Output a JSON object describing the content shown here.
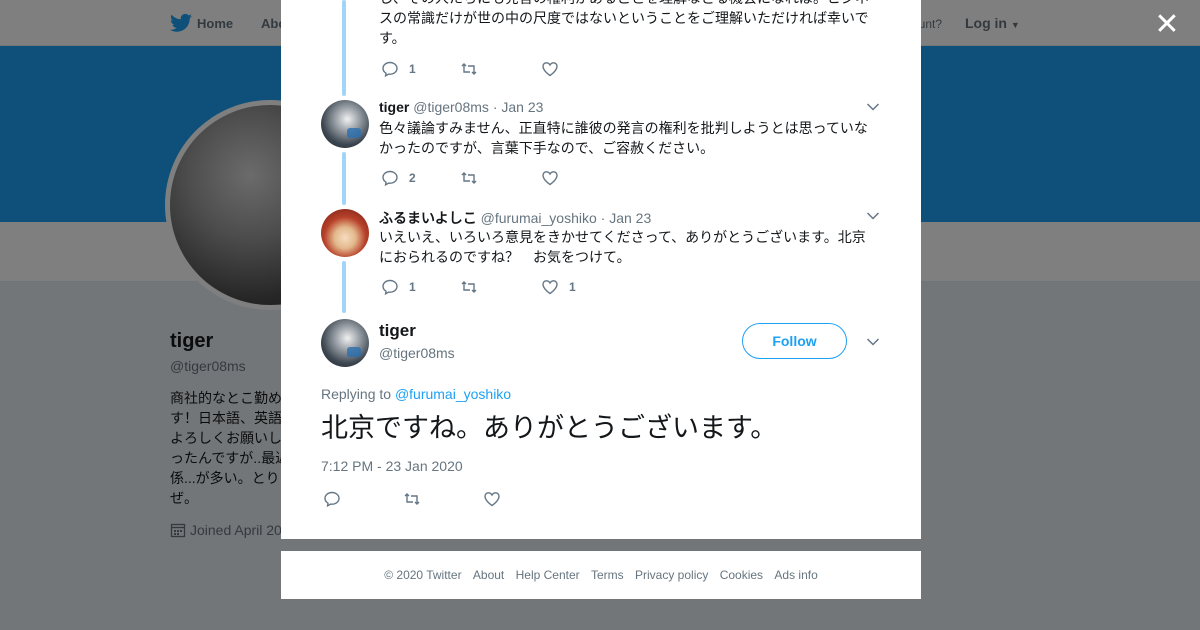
{
  "topbar": {
    "home": "Home",
    "about_partial": "Abo",
    "have_account_partial": "ccount?",
    "login": "Log in"
  },
  "profile": {
    "name": "tiger",
    "handle": "@tiger08ms",
    "bio": "商社的なとこ勤め\nす！日本語、英語\nよろしくお願いし\nったんですが..最近\n係...が多い。とり\nぜ。",
    "joined_partial": "Joined April 20"
  },
  "thread": [
    {
      "text": "し、その人たちにも発言の権利があることを理解などる機会になれば。ビジネスの常識だけが世の中の尺度ではないということをご理解いただければ幸いです。",
      "reply_count": "1",
      "retweet_count": "",
      "like_count": ""
    },
    {
      "name": "tiger",
      "handle": "@tiger08ms",
      "date": "· Jan 23",
      "text": "色々議論すみません、正直特に誰彼の発言の権利を批判しようとは思っていなかったのですが、言葉下手なので、ご容赦ください。",
      "reply_count": "2",
      "retweet_count": "",
      "like_count": ""
    },
    {
      "name": "ふるまいよしこ",
      "handle": "@furumai_yoshiko",
      "date": "· Jan 23",
      "text": "いえいえ、いろいろ意見をきかせてくださって、ありがとうございます。北京におられるのですね？　お気をつけて。",
      "reply_count": "1",
      "retweet_count": "",
      "like_count": "1"
    }
  ],
  "main_tweet": {
    "name": "tiger",
    "handle": "@tiger08ms",
    "follow_label": "Follow",
    "replying_to_label": "Replying to",
    "replying_to_handle": "@furumai_yoshiko",
    "text": "北京ですね。ありがとうございます。",
    "timestamp": "7:12 PM - 23 Jan 2020"
  },
  "footer": {
    "copyright": "© 2020 Twitter",
    "links": [
      "About",
      "Help Center",
      "Terms",
      "Privacy policy",
      "Cookies",
      "Ads info"
    ]
  },
  "colors": {
    "brand": "#1da1f2",
    "thread_line": "#a0d5f8",
    "secondary_text": "#66757f"
  },
  "icons": {
    "logo": "twitter-bird-icon",
    "close": "close-icon",
    "reply": "reply-icon",
    "retweet": "retweet-icon",
    "like": "heart-icon",
    "more": "chevron-down-icon",
    "calendar": "calendar-icon"
  }
}
